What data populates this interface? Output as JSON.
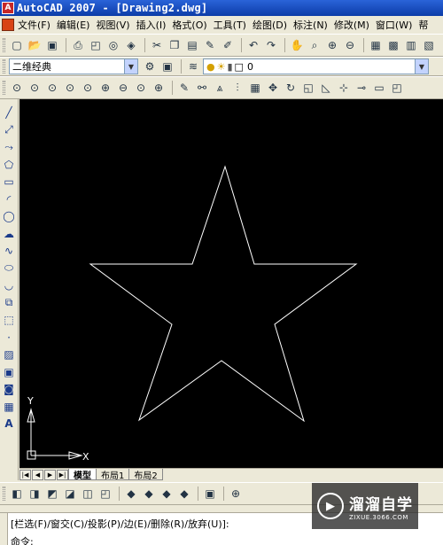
{
  "window": {
    "title": "AutoCAD 2007 - [Drawing2.dwg]"
  },
  "menu": [
    "文件(F)",
    "编辑(E)",
    "视图(V)",
    "插入(I)",
    "格式(O)",
    "工具(T)",
    "绘图(D)",
    "标注(N)",
    "修改(M)",
    "窗口(W)",
    "帮"
  ],
  "toolbar2": {
    "workspace_value": "二维经典",
    "layer_value": "0"
  },
  "tabs": [
    "模型",
    "布局1",
    "布局2"
  ],
  "ucs": {
    "x_label": "X",
    "y_label": "Y"
  },
  "command": {
    "prompt_line": "[栏选(F)/窗交(C)/投影(P)/边(E)/删除(R)/放弃(U)]:",
    "input_label": "命令:"
  },
  "watermark": {
    "brand": "溜溜自学",
    "url": "ZIXUE.3066.COM"
  },
  "icons": {
    "toolbar1": [
      "new-icon",
      "open-icon",
      "save-icon",
      "print-icon",
      "preview-icon",
      "publish-icon",
      "plot-3d-icon",
      "cut-icon",
      "copy-icon",
      "paste-icon",
      "matchprop-icon",
      "brush-icon",
      "undo-icon",
      "redo-icon",
      "pan-icon",
      "zoom-realtime-icon",
      "zoom-window-icon",
      "zoom-prev-icon",
      "properties-icon",
      "designcenter-icon",
      "toolpalette-icon",
      "sheetset-icon"
    ],
    "toolbar3": [
      "zoom-window-icon",
      "zoom-dynamic-icon",
      "zoom-scale-icon",
      "zoom-center-icon",
      "zoom-object-icon",
      "zoom-in-icon",
      "zoom-out-icon",
      "zoom-all-icon",
      "zoom-extents-icon",
      "erase-icon",
      "copy-object-icon",
      "mirror-icon",
      "offset-icon",
      "array-icon",
      "move-icon",
      "rotate-icon",
      "scale-icon",
      "stretch-icon",
      "trim-icon",
      "extend-icon",
      "break-icon",
      "join-icon"
    ],
    "left": [
      "line-icon",
      "xline-icon",
      "polyline-icon",
      "polygon-icon",
      "rectangle-icon",
      "arc-icon",
      "circle-icon",
      "revcloud-icon",
      "spline-icon",
      "ellipse-icon",
      "ellipse-arc-icon",
      "insert-block-icon",
      "make-block-icon",
      "point-icon",
      "hatch-icon",
      "gradient-icon",
      "region-icon",
      "table-icon",
      "mtext-icon"
    ],
    "bottom": [
      "view-top-icon",
      "view-bottom-icon",
      "view-left-icon",
      "view-right-icon",
      "view-front-icon",
      "view-back-icon",
      "iso-sw-icon",
      "iso-se-icon",
      "iso-ne-icon",
      "iso-nw-icon",
      "camera-icon"
    ]
  },
  "colors": {
    "canvas": "#000000",
    "star_stroke": "#ffffff",
    "titlebar": "#0c3ca8"
  }
}
